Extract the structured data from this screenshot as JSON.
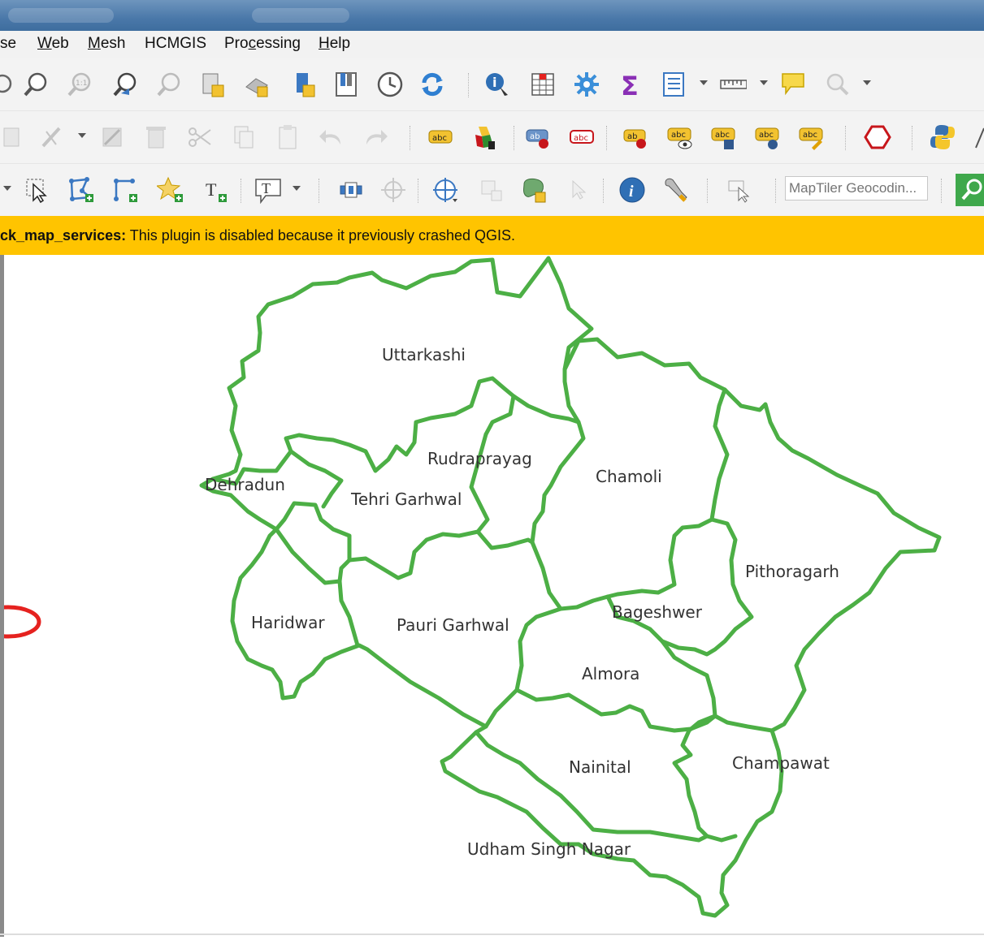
{
  "menubar": {
    "items": [
      {
        "label": "se",
        "accel": ""
      },
      {
        "label": "Web",
        "accel": "W"
      },
      {
        "label": "Mesh",
        "accel": "M"
      },
      {
        "label": "HCMGIS",
        "accel": ""
      },
      {
        "label": "Processing",
        "accel": "c"
      },
      {
        "label": "Help",
        "accel": "H"
      }
    ]
  },
  "toolbar_search": {
    "placeholder": "MapTiler Geocodin..."
  },
  "message_bar": {
    "plugin": "ck_map_services:",
    "text": " This plugin is disabled because it previously crashed QGIS."
  },
  "map": {
    "border_color": "#4caf45",
    "districts": [
      {
        "name": "Uttarkashi"
      },
      {
        "name": "Rudraprayag"
      },
      {
        "name": "Chamoli"
      },
      {
        "name": "Dehradun"
      },
      {
        "name": "Tehri Garhwal"
      },
      {
        "name": "Pithoragarh"
      },
      {
        "name": "Bageshwer"
      },
      {
        "name": "Haridwar"
      },
      {
        "name": "Pauri Garhwal"
      },
      {
        "name": "Almora"
      },
      {
        "name": "Nainital"
      },
      {
        "name": "Champawat"
      },
      {
        "name": "Udham Singh Nagar"
      }
    ]
  },
  "colors": {
    "message_bar": "#ffc400",
    "titlebar": "#4a78a9",
    "annotation": "#e5221f"
  }
}
